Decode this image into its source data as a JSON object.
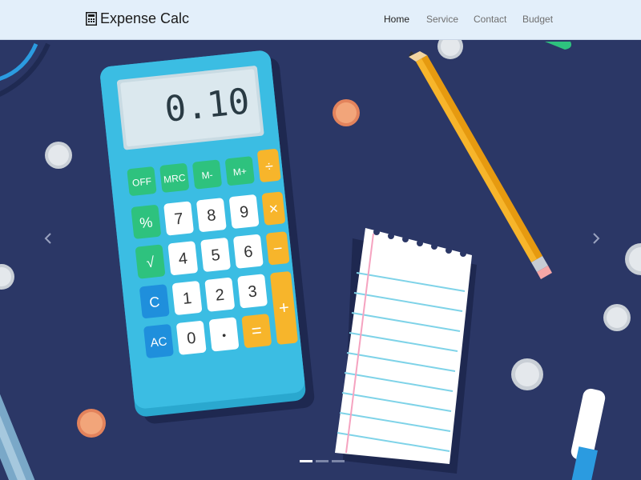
{
  "navbar": {
    "brand": "Expense Calc",
    "links": [
      {
        "label": "Home",
        "active": true
      },
      {
        "label": "Service",
        "active": false
      },
      {
        "label": "Contact",
        "active": false
      },
      {
        "label": "Budget",
        "active": false
      }
    ]
  },
  "carousel": {
    "prev_icon": "chevron-left-icon",
    "next_icon": "chevron-right-icon",
    "slide_count": 3,
    "active_slide": 1
  },
  "illustration": {
    "display": "0.10",
    "keys": {
      "off": "OFF",
      "mrc": "MRC",
      "m_minus": "M-",
      "m_plus": "M+",
      "divide": "÷",
      "percent": "%",
      "seven": "7",
      "eight": "8",
      "nine": "9",
      "times": "×",
      "sqrt": "√",
      "four": "4",
      "five": "5",
      "six": "6",
      "minus": "−",
      "clear": "C",
      "one": "1",
      "two": "2",
      "three": "3",
      "plus": "+",
      "all_clear": "AC",
      "zero": "0",
      "dot": "•",
      "equals": "="
    }
  },
  "colors": {
    "navbar_bg": "#e3effa",
    "hero_bg": "#2b3766",
    "calculator_body": "#2aa8cf",
    "key_green": "#2ec27e",
    "key_orange": "#f7b52b",
    "key_blue": "#1f8fdc",
    "key_white": "#ffffff"
  }
}
